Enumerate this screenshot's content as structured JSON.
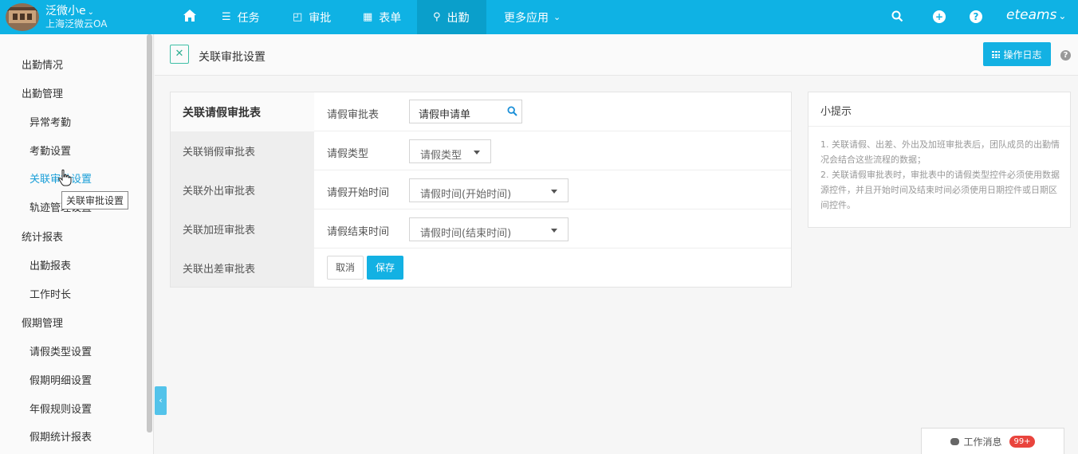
{
  "topbar": {
    "user_name": "泛微小e",
    "org_name": "上海泛微云OA",
    "nav": [
      {
        "label": "任务"
      },
      {
        "label": "审批"
      },
      {
        "label": "表单"
      },
      {
        "label": "出勤"
      },
      {
        "label": "更多应用"
      }
    ],
    "brand": "eteams",
    "active_nav": "出勤"
  },
  "sidebar": {
    "items": [
      {
        "label": "出勤情况"
      },
      {
        "label": "出勤管理"
      },
      {
        "label": "异常考勤"
      },
      {
        "label": "考勤设置"
      },
      {
        "label": "关联审批设置"
      },
      {
        "label": "轨迹管理设置"
      },
      {
        "label": "统计报表"
      },
      {
        "label": "出勤报表"
      },
      {
        "label": "工作时长"
      },
      {
        "label": "假期管理"
      },
      {
        "label": "请假类型设置"
      },
      {
        "label": "假期明细设置"
      },
      {
        "label": "年假规则设置"
      },
      {
        "label": "假期统计报表"
      }
    ],
    "tooltip": "关联审批设置"
  },
  "header": {
    "title": "关联审批设置",
    "log_button": "操作日志"
  },
  "left_tabs": [
    {
      "label": "关联请假审批表"
    },
    {
      "label": "关联销假审批表"
    },
    {
      "label": "关联外出审批表"
    },
    {
      "label": "关联加班审批表"
    },
    {
      "label": "关联出差审批表"
    }
  ],
  "form": {
    "rows": [
      {
        "label": "请假审批表",
        "value": "请假申请单"
      },
      {
        "label": "请假类型",
        "value": "请假类型"
      },
      {
        "label": "请假开始时间",
        "value": "请假时间(开始时间)"
      },
      {
        "label": "请假结束时间",
        "value": "请假时间(结束时间)"
      }
    ],
    "cancel_label": "取消",
    "save_label": "保存"
  },
  "tips": {
    "title": "小提示",
    "line1": "1. 关联请假、出差、外出及加班审批表后，团队成员的出勤情况会结合这些流程的数据；",
    "line2": "2. 关联请假审批表时，审批表中的请假类型控件必须使用数据源控件，并且开始时间及结束时间必须使用日期控件或日期区间控件。"
  },
  "messages": {
    "label": "工作消息",
    "count": "99+"
  },
  "colors": {
    "topbar": "#0fb2e4",
    "active_nav": "#0a9fcb",
    "primary_button": "#13b1e3",
    "active_link": "#1a9fd8",
    "badge": "#e9443d"
  }
}
